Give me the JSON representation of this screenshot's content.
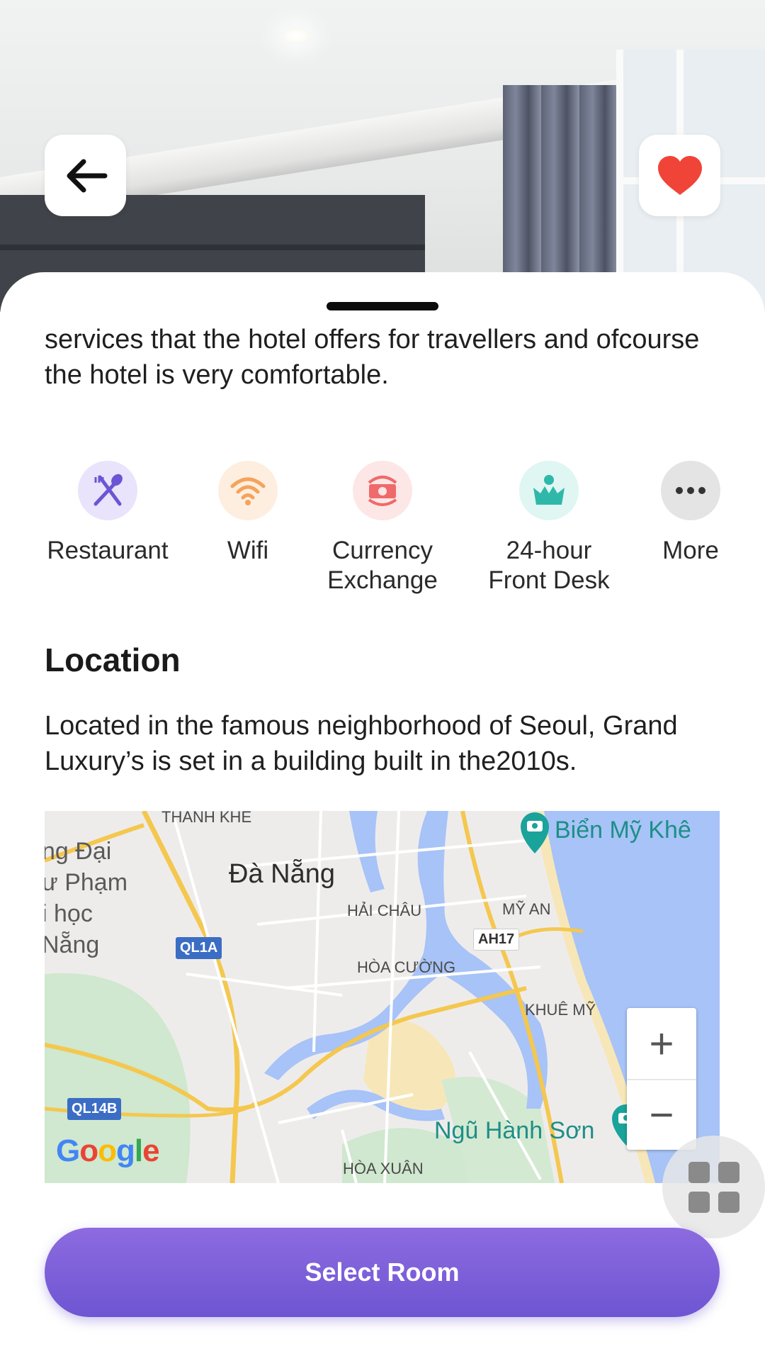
{
  "description_text": "services that the hotel offers for travellers and ofcourse the hotel is very comfortable.",
  "amenities": [
    {
      "label": "Restaurant",
      "icon": "restaurant-icon",
      "color": "#6c55d4",
      "bg": "#e9e4fb"
    },
    {
      "label": "Wifi",
      "icon": "wifi-icon",
      "color": "#f5a35b",
      "bg": "#fdeee0"
    },
    {
      "label": "Currency\nExchange",
      "icon": "currency-exchange-icon",
      "color": "#ef6a6a",
      "bg": "#fde6e6"
    },
    {
      "label": "24-hour\nFront Desk",
      "icon": "front-desk-icon",
      "color": "#2fb8aa",
      "bg": "#dff6f3"
    },
    {
      "label": "More",
      "icon": "more-icon",
      "color": "#333333",
      "bg": "#e4e4e4"
    }
  ],
  "location": {
    "title": "Location",
    "text": "Located in the famous neighborhood of Seoul, Grand Luxury’s is set in a building built in the2010s."
  },
  "map": {
    "city": "Đà Nẵng",
    "labels": {
      "thanh_khe": "THANH KHE",
      "hai_chau": "HẢI CHÂU",
      "my_an": "MỸ AN",
      "hoa_cuong": "HÒA CƯỜNG",
      "khue_my": "KHUÊ MỸ",
      "hoa_xuan": "HÒA XUÂN"
    },
    "left_labels": [
      "ng Đại",
      "ư Phạm",
      "i học",
      "Nẵng"
    ],
    "pois": {
      "bien_my_khe": "Biển Mỹ Khê",
      "ngu_hanh_son": "Ngũ Hành Sơn"
    },
    "shields": {
      "ql1a": "QL1A",
      "ql14b": "QL14B",
      "ah17": "AH17"
    },
    "zoom_in": "+",
    "zoom_out": "−",
    "google": [
      "G",
      "o",
      "o",
      "g",
      "l",
      "e"
    ]
  },
  "cta": {
    "label": "Select Room",
    "color": "#7b5fdc"
  },
  "colors": {
    "favorite": "#f04438",
    "accent": "#7b5fdc"
  }
}
